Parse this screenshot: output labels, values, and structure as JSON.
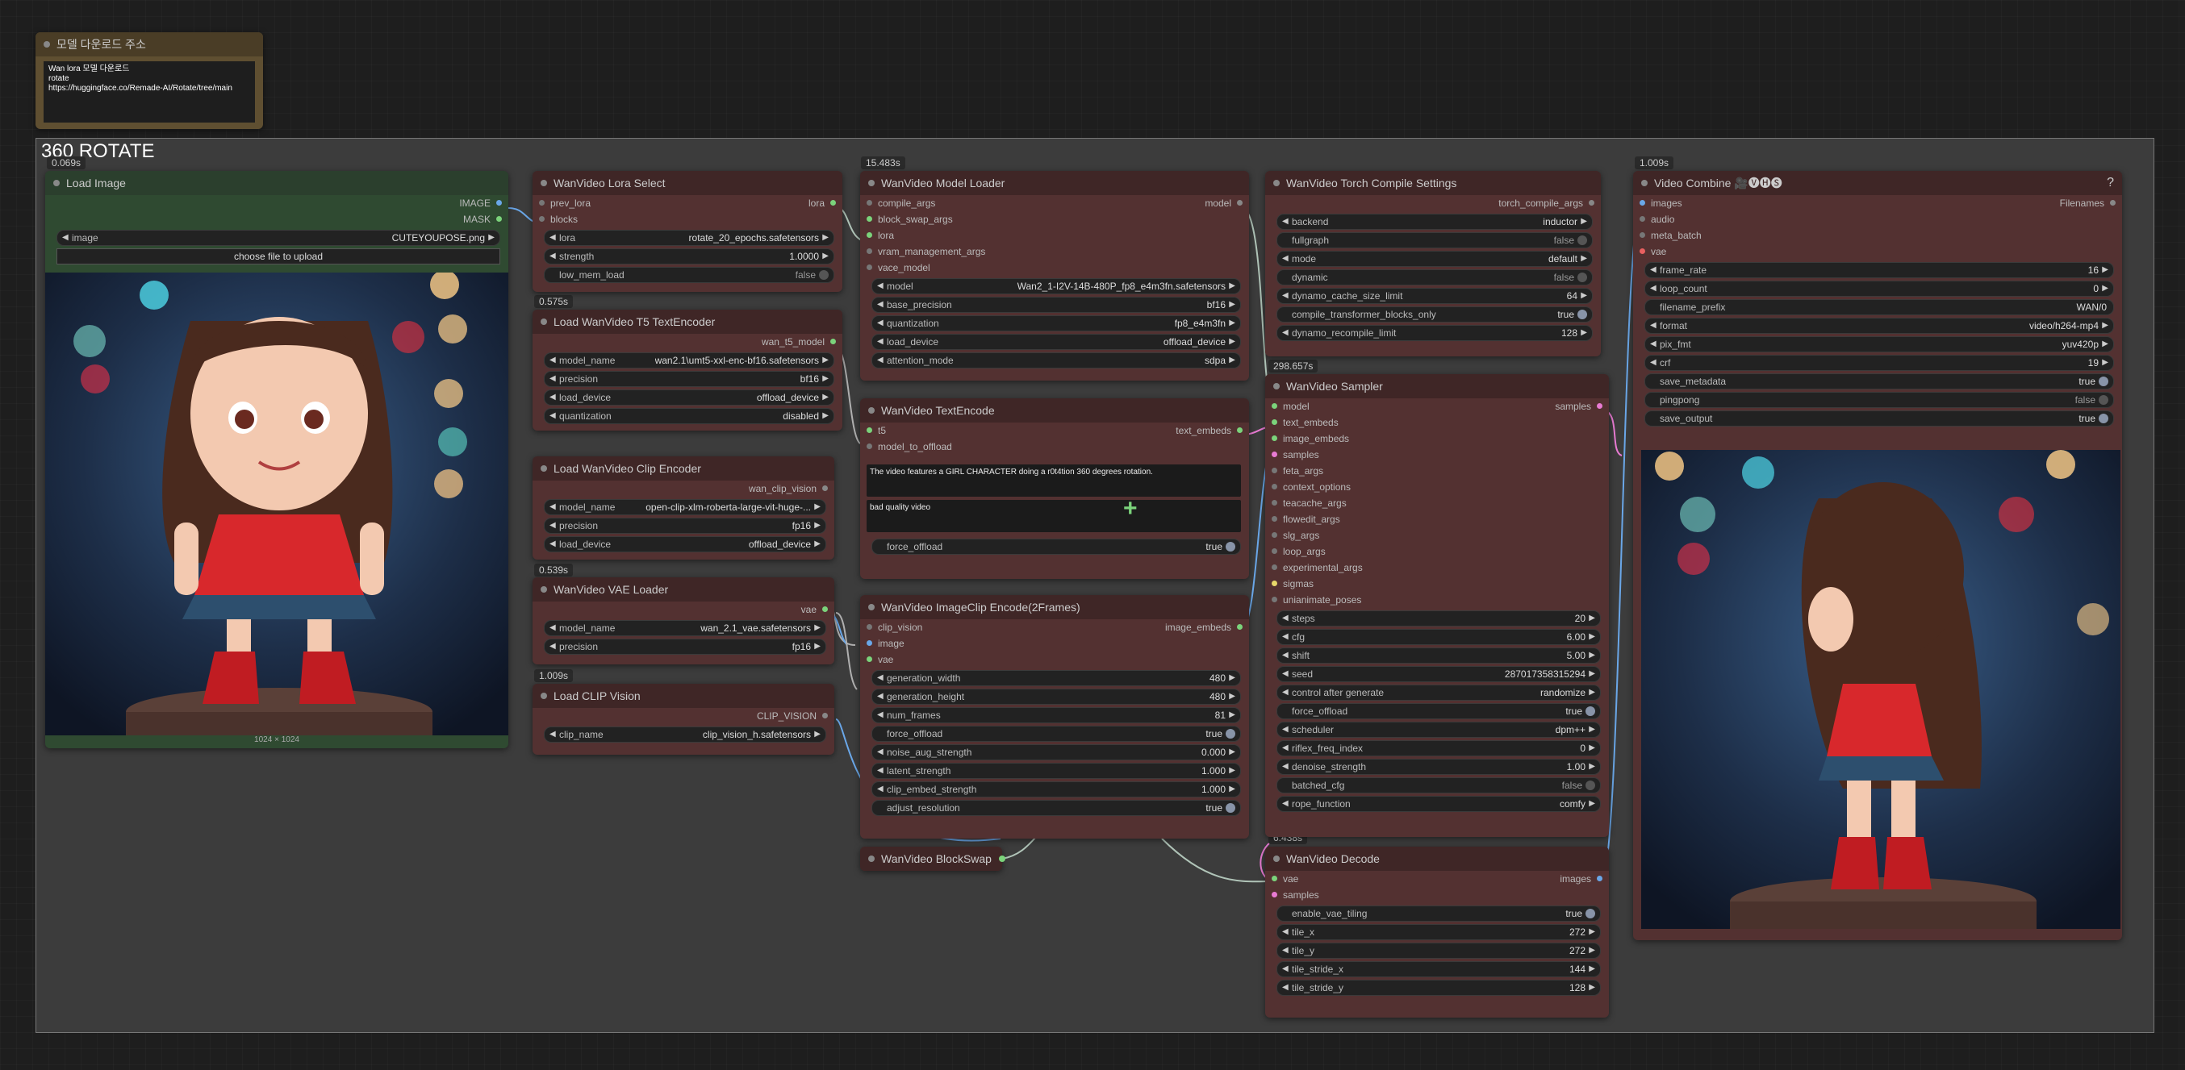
{
  "group": {
    "title": "360 ROTATE"
  },
  "timings": {
    "load_image": "0.069s",
    "model_loader": "15.483s",
    "t5_encoder": "0.575s",
    "clip_encoder": "0.539s",
    "vae_loader": "1.009s",
    "sampler": "298.657s",
    "decode": "6.438s",
    "video_combine": "1.009s"
  },
  "note_node": {
    "title": "모델 다운로드 주소",
    "lines": [
      "Wan lora 모델 다운로드",
      "rotate",
      "https://huggingface.co/Remade-AI/Rotate/tree/main"
    ]
  },
  "load_image": {
    "title": "Load Image",
    "outputs": [
      "IMAGE",
      "MASK"
    ],
    "image_label": "image",
    "image_value": "CUTEYOUPOSE.png",
    "upload_button": "choose file to upload",
    "dimensions": "1024 × 1024"
  },
  "lora_select": {
    "title": "WanVideo Lora Select",
    "inputs": [
      "prev_lora",
      "blocks"
    ],
    "output": "lora",
    "widgets": [
      {
        "label": "lora",
        "value": "rotate_20_epochs.safetensors"
      },
      {
        "label": "strength",
        "value": "1.0000"
      },
      {
        "label": "low_mem_load",
        "value": "false"
      }
    ]
  },
  "t5_encoder": {
    "title": "Load WanVideo T5 TextEncoder",
    "output": "wan_t5_model",
    "widgets": [
      {
        "label": "model_name",
        "value": "wan2.1\\umt5-xxl-enc-bf16.safetensors"
      },
      {
        "label": "precision",
        "value": "bf16"
      },
      {
        "label": "load_device",
        "value": "offload_device"
      },
      {
        "label": "quantization",
        "value": "disabled"
      }
    ]
  },
  "clip_encoder": {
    "title": "Load WanVideo Clip Encoder",
    "output": "wan_clip_vision",
    "widgets": [
      {
        "label": "model_name",
        "value": "open-clip-xlm-roberta-large-vit-huge-..."
      },
      {
        "label": "precision",
        "value": "fp16"
      },
      {
        "label": "load_device",
        "value": "offload_device"
      }
    ]
  },
  "vae_loader": {
    "title": "WanVideo VAE Loader",
    "output": "vae",
    "widgets": [
      {
        "label": "model_name",
        "value": "wan_2.1_vae.safetensors"
      },
      {
        "label": "precision",
        "value": "fp16"
      }
    ]
  },
  "clip_vision": {
    "title": "Load CLIP Vision",
    "output": "CLIP_VISION",
    "widgets": [
      {
        "label": "clip_name",
        "value": "clip_vision_h.safetensors"
      }
    ]
  },
  "model_loader": {
    "title": "WanVideo Model Loader",
    "inputs": [
      "compile_args",
      "block_swap_args",
      "lora",
      "vram_management_args",
      "vace_model"
    ],
    "output": "model",
    "widgets": [
      {
        "label": "model",
        "value": "Wan2_1-I2V-14B-480P_fp8_e4m3fn.safetensors"
      },
      {
        "label": "base_precision",
        "value": "bf16"
      },
      {
        "label": "quantization",
        "value": "fp8_e4m3fn"
      },
      {
        "label": "load_device",
        "value": "offload_device"
      },
      {
        "label": "attention_mode",
        "value": "sdpa"
      }
    ]
  },
  "text_encode": {
    "title": "WanVideo TextEncode",
    "inputs": [
      "t5",
      "model_to_offload"
    ],
    "output": "text_embeds",
    "positive": "The video features a GIRL CHARACTER doing a r0t4tion 360 degrees rotation.",
    "negative": "bad quality video",
    "force_offload": {
      "label": "force_offload",
      "value": "true"
    }
  },
  "imageclip_encode": {
    "title": "WanVideo ImageClip Encode(2Frames)",
    "inputs": [
      "clip_vision",
      "image",
      "vae"
    ],
    "output": "image_embeds",
    "widgets": [
      {
        "label": "generation_width",
        "value": "480"
      },
      {
        "label": "generation_height",
        "value": "480"
      },
      {
        "label": "num_frames",
        "value": "81"
      },
      {
        "label": "force_offload",
        "value": "true",
        "toggle": true
      },
      {
        "label": "noise_aug_strength",
        "value": "0.000"
      },
      {
        "label": "latent_strength",
        "value": "1.000"
      },
      {
        "label": "clip_embed_strength",
        "value": "1.000"
      },
      {
        "label": "adjust_resolution",
        "value": "true",
        "toggle": true
      }
    ]
  },
  "block_swap": {
    "title": "WanVideo BlockSwap"
  },
  "torch_compile": {
    "title": "WanVideo Torch Compile Settings",
    "output": "torch_compile_args",
    "widgets": [
      {
        "label": "backend",
        "value": "inductor"
      },
      {
        "label": "fullgraph",
        "value": "false",
        "toggle": true
      },
      {
        "label": "mode",
        "value": "default"
      },
      {
        "label": "dynamic",
        "value": "false",
        "toggle": true
      },
      {
        "label": "dynamo_cache_size_limit",
        "value": "64"
      },
      {
        "label": "compile_transformer_blocks_only",
        "value": "true",
        "toggle": true
      },
      {
        "label": "dynamo_recompile_limit",
        "value": "128"
      }
    ]
  },
  "sampler": {
    "title": "WanVideo Sampler",
    "inputs": [
      "model",
      "text_embeds",
      "image_embeds",
      "samples",
      "feta_args",
      "context_options",
      "teacache_args",
      "flowedit_args",
      "slg_args",
      "loop_args",
      "experimental_args",
      "sigmas",
      "unianimate_poses"
    ],
    "output": "samples",
    "widgets": [
      {
        "label": "steps",
        "value": "20"
      },
      {
        "label": "cfg",
        "value": "6.00"
      },
      {
        "label": "shift",
        "value": "5.00"
      },
      {
        "label": "seed",
        "value": "287017358315294"
      },
      {
        "label": "control after generate",
        "value": "randomize"
      },
      {
        "label": "force_offload",
        "value": "true",
        "toggle": true
      },
      {
        "label": "scheduler",
        "value": "dpm++"
      },
      {
        "label": "riflex_freq_index",
        "value": "0"
      },
      {
        "label": "denoise_strength",
        "value": "1.00"
      },
      {
        "label": "batched_cfg",
        "value": "false",
        "toggle": true
      },
      {
        "label": "rope_function",
        "value": "comfy"
      }
    ]
  },
  "decode": {
    "title": "WanVideo Decode",
    "inputs": [
      "vae",
      "samples"
    ],
    "output": "images",
    "widgets": [
      {
        "label": "enable_vae_tiling",
        "value": "true",
        "toggle": true
      },
      {
        "label": "tile_x",
        "value": "272"
      },
      {
        "label": "tile_y",
        "value": "272"
      },
      {
        "label": "tile_stride_x",
        "value": "144"
      },
      {
        "label": "tile_stride_y",
        "value": "128"
      }
    ]
  },
  "video_combine": {
    "title": "Video Combine 🎥🅥🅗🅢",
    "help": "?",
    "inputs": [
      "images",
      "audio",
      "meta_batch",
      "vae"
    ],
    "output": "Filenames",
    "widgets": [
      {
        "label": "frame_rate",
        "value": "16"
      },
      {
        "label": "loop_count",
        "value": "0"
      },
      {
        "label": "filename_prefix",
        "value": "WAN/0",
        "text": true
      },
      {
        "label": "format",
        "value": "video/h264-mp4"
      },
      {
        "label": "pix_fmt",
        "value": "yuv420p"
      },
      {
        "label": "crf",
        "value": "19"
      },
      {
        "label": "save_metadata",
        "value": "true",
        "toggle": true
      },
      {
        "label": "pingpong",
        "value": "false",
        "toggle": true
      },
      {
        "label": "save_output",
        "value": "true",
        "toggle": true
      }
    ]
  }
}
